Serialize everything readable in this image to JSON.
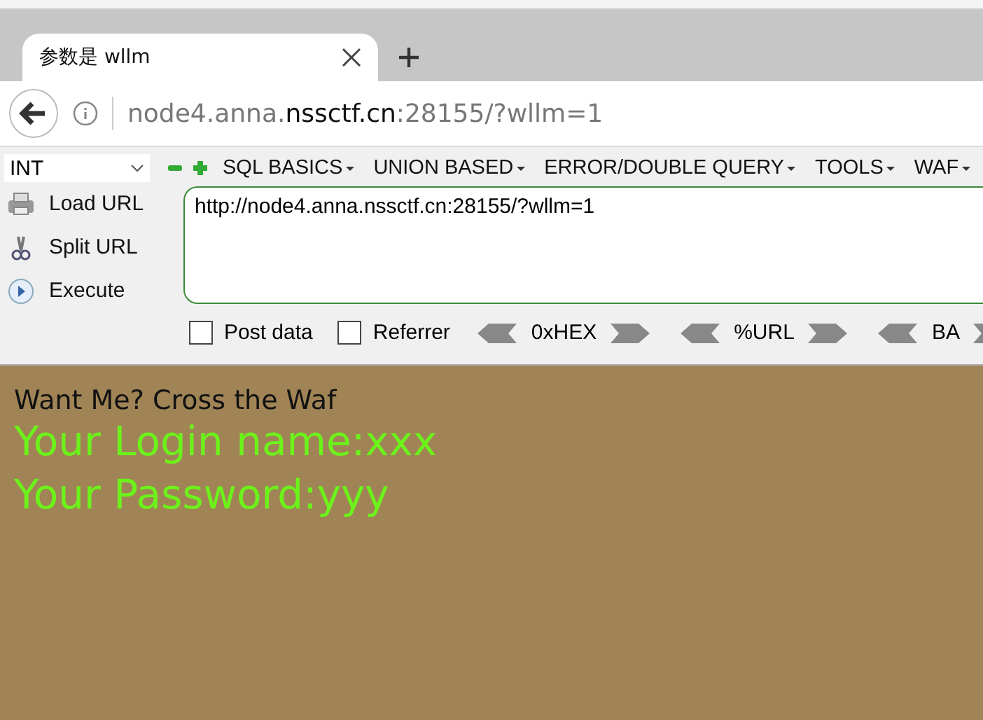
{
  "tabs": [
    {
      "title": "参数是 wllm",
      "selected": true
    }
  ],
  "address_bar": {
    "host_prefix": "node4.anna.",
    "host_domain": "nssctf.cn",
    "rest": ":28155/?wllm=1"
  },
  "hackbar": {
    "select_value": "INT",
    "menus": [
      {
        "label": "SQL BASICS"
      },
      {
        "label": "UNION BASED"
      },
      {
        "label": "ERROR/DOUBLE QUERY"
      },
      {
        "label": "TOOLS"
      },
      {
        "label": "WAF"
      }
    ],
    "actions": [
      {
        "kind": "load",
        "label": "Load URL"
      },
      {
        "kind": "split",
        "label": "Split URL"
      },
      {
        "kind": "execute",
        "label": "Execute"
      }
    ],
    "url_value": "http://node4.anna.nssctf.cn:28155/?wllm=1",
    "checkboxes": [
      {
        "label": "Post data",
        "checked": false
      },
      {
        "label": "Referrer",
        "checked": false
      }
    ],
    "encoders": [
      {
        "label": "0xHEX"
      },
      {
        "label": "%URL"
      },
      {
        "label": "BA"
      }
    ]
  },
  "page": {
    "heading": "Want Me? Cross the Waf",
    "login_line": "Your Login name:xxx",
    "password_line": "Your Password:yyy"
  }
}
